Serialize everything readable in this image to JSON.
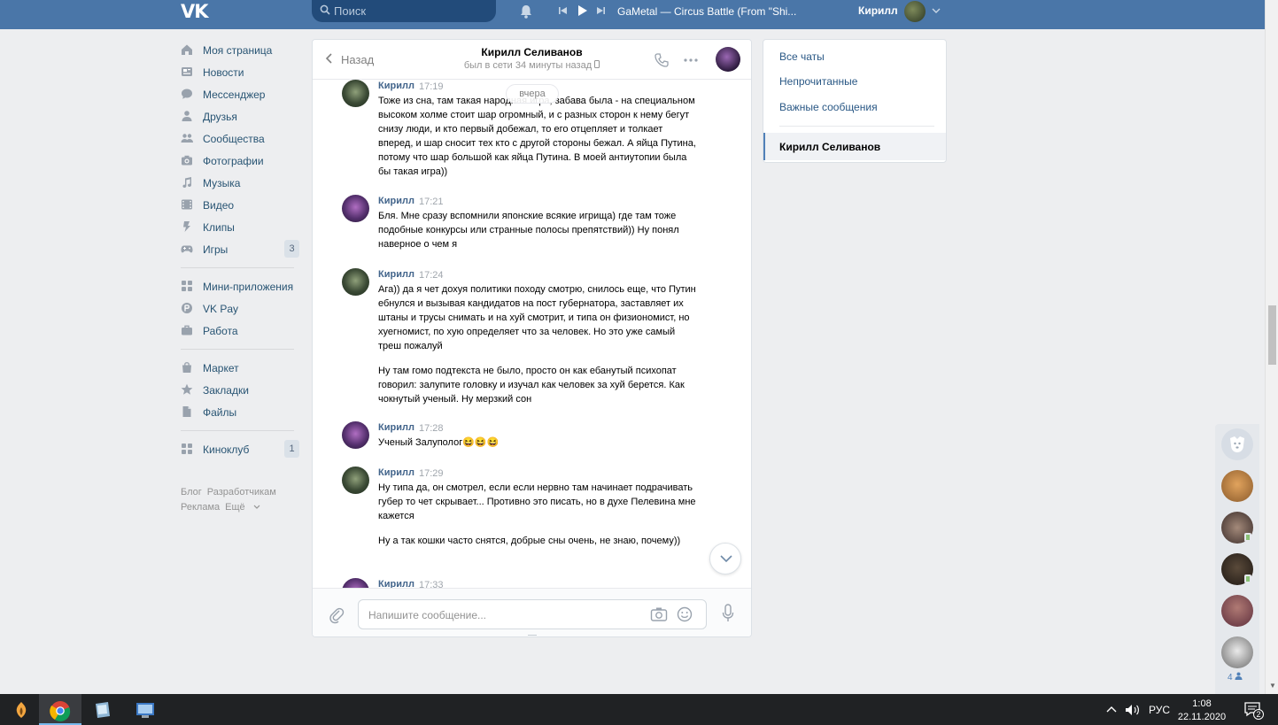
{
  "topbar": {
    "logo": "VK",
    "search_placeholder": "Поиск",
    "track": "GaMetal — Circus Battle (From \"Shi...",
    "user_name": "Кирилл"
  },
  "nav": {
    "group1": [
      {
        "label": "Моя страница",
        "icon": "home-icon"
      },
      {
        "label": "Новости",
        "icon": "news-icon"
      },
      {
        "label": "Мессенджер",
        "icon": "messenger-icon"
      },
      {
        "label": "Друзья",
        "icon": "friends-icon"
      },
      {
        "label": "Сообщества",
        "icon": "communities-icon"
      },
      {
        "label": "Фотографии",
        "icon": "camera-icon"
      },
      {
        "label": "Музыка",
        "icon": "music-icon"
      },
      {
        "label": "Видео",
        "icon": "video-icon"
      },
      {
        "label": "Клипы",
        "icon": "clips-icon"
      },
      {
        "label": "Игры",
        "icon": "games-icon",
        "badge": "3"
      }
    ],
    "group2": [
      {
        "label": "Мини-приложения",
        "icon": "apps-icon"
      },
      {
        "label": "VK Pay",
        "icon": "vkpay-icon"
      },
      {
        "label": "Работа",
        "icon": "work-icon"
      }
    ],
    "group3": [
      {
        "label": "Маркет",
        "icon": "market-icon"
      },
      {
        "label": "Закладки",
        "icon": "star-icon"
      },
      {
        "label": "Файлы",
        "icon": "file-icon"
      }
    ],
    "group4": [
      {
        "label": "Киноклуб",
        "icon": "apps-icon",
        "badge": "1"
      }
    ],
    "footer": {
      "blog": "Блог",
      "dev": "Разработчикам",
      "ads": "Реклама",
      "more": "Ещё"
    }
  },
  "chat": {
    "back_label": "Назад",
    "peer_name": "Кирилл Селиванов",
    "peer_status": "был в сети 34 минуты назад",
    "date_pill": "вчера",
    "messages": [
      {
        "author": "Кирилл",
        "time": "17:19",
        "avatar": "a",
        "paragraphs": [
          "Тоже из сна, там такая народная игра, забава была - на специальном высоком холме стоит шар огромный, и с разных сторон к нему бегут снизу люди, и кто первый добежал, то его отцепляет и толкает вперед, и шар сносит тех кто с другой стороны бежал. А яйца Путина, потому что шар большой как яйца Путина. В моей антиутопии была бы такая игра))"
        ]
      },
      {
        "author": "Кирилл",
        "time": "17:21",
        "avatar": "b",
        "paragraphs": [
          "Бля. Мне сразу вспомнили японские всякие игрища) где там тоже подобные конкурсы или странные полосы препятствий)) Ну понял наверное о чем я"
        ]
      },
      {
        "author": "Кирилл",
        "time": "17:24",
        "avatar": "a",
        "paragraphs": [
          "Ага)) да я чет дохуя политики походу смотрю, снилось еще, что Путин ебнулся и вызывая кандидатов на пост губернатора, заставляет их штаны и трусы снимать и на хуй смотрит, и типа он физиономист, но хуегномист, по хую определяет что за человек. Но это уже самый треш пожалуй",
          "Ну там гомо подтекста не было, просто он как ебанутый психопат говорил: залупите головку и изучал как человек за хуй берется. Как чокнутый ученый. Ну мерзкий сон"
        ]
      },
      {
        "author": "Кирилл",
        "time": "17:28",
        "avatar": "b",
        "paragraphs": [
          "Ученый Залуполог😆😆😆"
        ]
      },
      {
        "author": "Кирилл",
        "time": "17:29",
        "avatar": "a",
        "paragraphs": [
          "Ну типа да, он смотрел, если если нервно там начинает подрачивать губер то чет скрывает... Противно это писать, но в духе Пелевина мне кажется",
          "Ну а так кошки часто снятся, добрые сны очень, не знаю, почему))"
        ]
      },
      {
        "author": "Кирилл",
        "time": "17:33",
        "avatar": "b",
        "paragraphs": []
      }
    ],
    "composer_placeholder": "Напишите сообщение..."
  },
  "right_panel": {
    "all_chats": "Все чаты",
    "unread": "Непрочитанные",
    "important": "Важные сообщения",
    "active_chat": "Кирилл Селиванов"
  },
  "fast_chat": {
    "online_count": "4"
  },
  "taskbar": {
    "lang": "РУС",
    "time": "1:08",
    "date": "22.11.2020",
    "notifications": "2"
  }
}
